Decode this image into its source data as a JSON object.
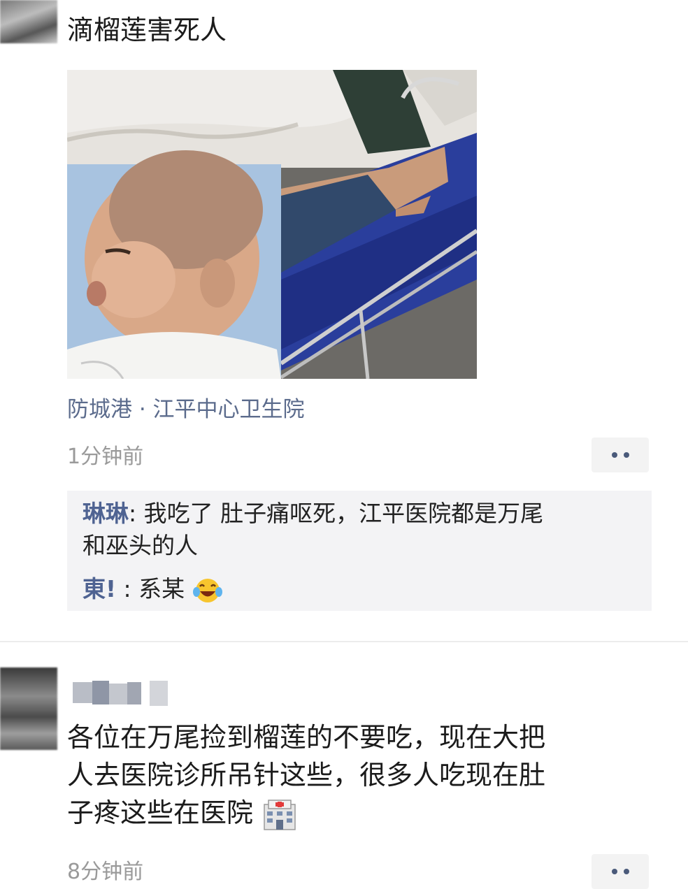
{
  "post1": {
    "text": "滴榴莲害死人",
    "location": "防城港 · 江平中心卫生院",
    "time": "1分钟前",
    "comments": [
      {
        "name": "琳琳",
        "sep": ": ",
        "text_line1": "我吃了 肚子痛呕死，江平医院都是万尾",
        "text_line2": "和巫头的人"
      },
      {
        "name": "東!",
        "sep": " : ",
        "text": "系某"
      }
    ]
  },
  "post2": {
    "text_line1": "各位在万尾捡到榴莲的不要吃，现在大把",
    "text_line2": "人去医院诊所吊针这些，很多人吃现在肚",
    "text_line3": "子疼这些在医院",
    "time": "8分钟前"
  },
  "icons": {
    "more": "more-dots-icon",
    "laugh": "laughing-tears-emoji-icon",
    "hospital": "hospital-emoji-icon"
  },
  "colors": {
    "name_link": "#4f6392",
    "location": "#5b6b8c",
    "time": "#9a9a9a",
    "comment_bg": "#f3f3f5"
  }
}
